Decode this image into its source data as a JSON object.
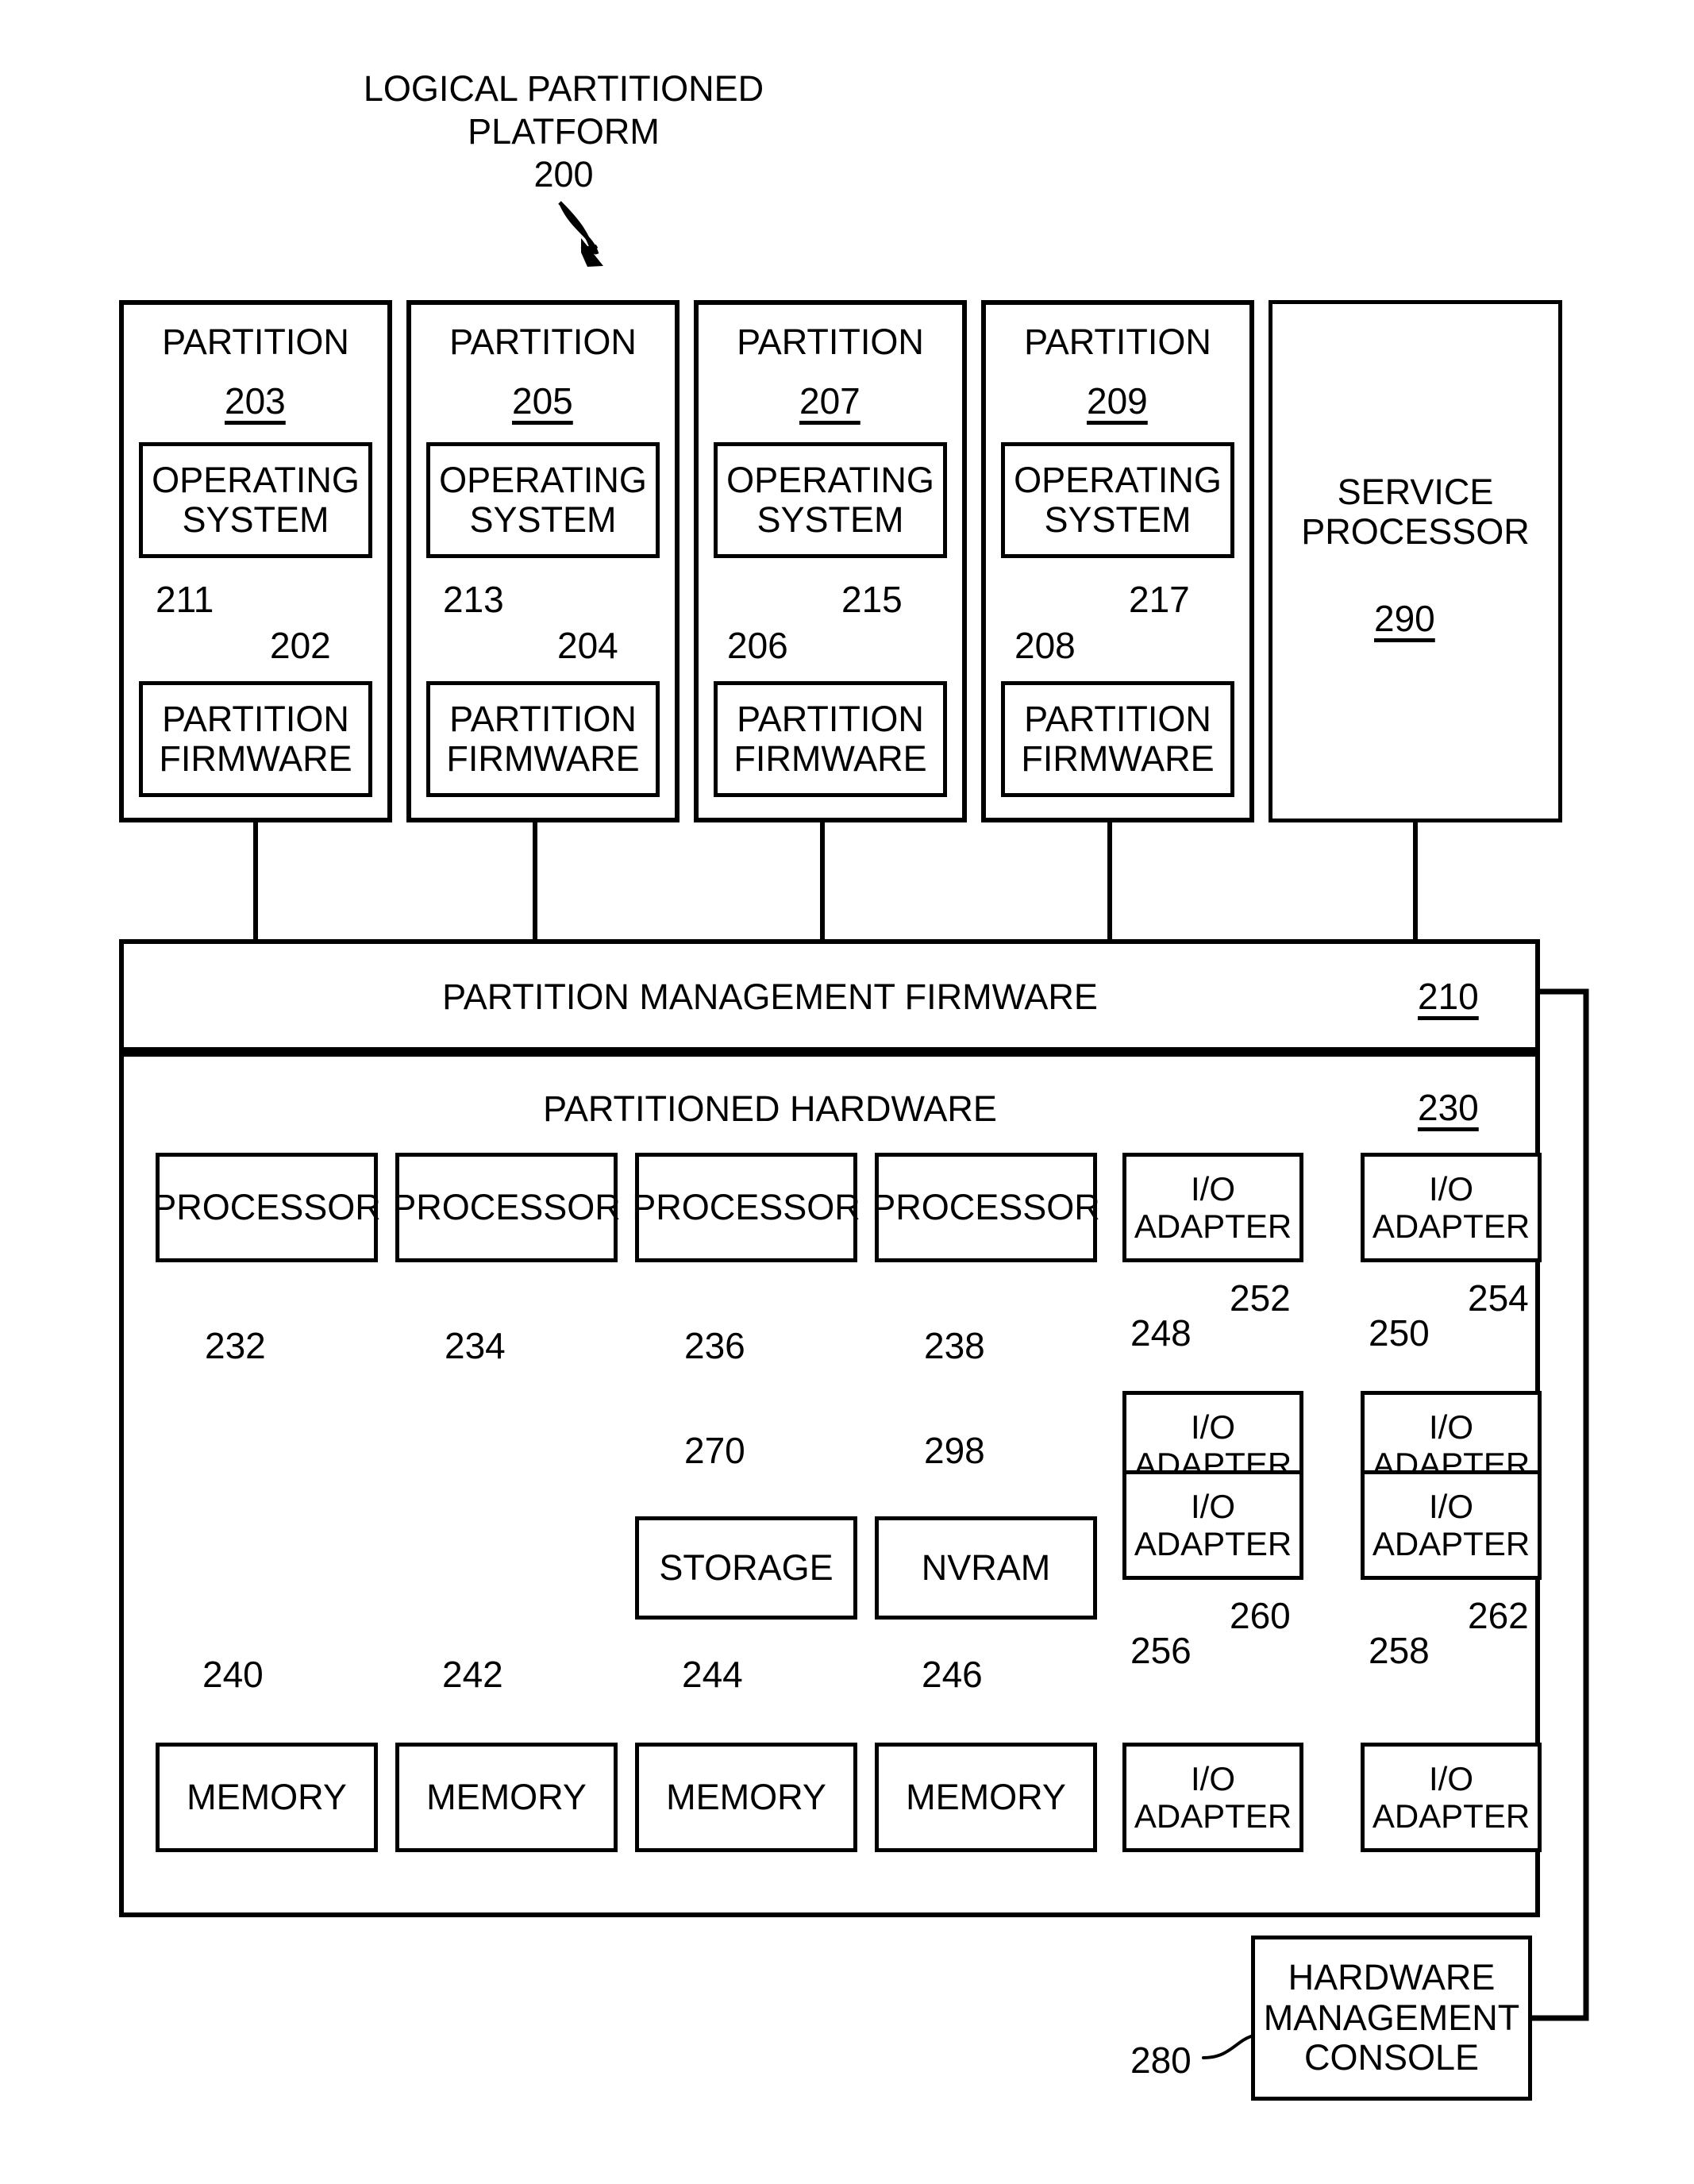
{
  "figure": {
    "title_line1": "LOGICAL PARTITIONED",
    "title_line2": "PLATFORM",
    "title_ref": "200"
  },
  "partitions": [
    {
      "name": "PARTITION",
      "ref": "203",
      "os_label_l1": "OPERATING",
      "os_label_l2": "SYSTEM",
      "fw_label_l1": "PARTITION",
      "fw_label_l2": "FIRMWARE",
      "ref_left": "211",
      "ref_right": "202"
    },
    {
      "name": "PARTITION",
      "ref": "205",
      "os_label_l1": "OPERATING",
      "os_label_l2": "SYSTEM",
      "fw_label_l1": "PARTITION",
      "fw_label_l2": "FIRMWARE",
      "ref_left": "213",
      "ref_right": "204"
    },
    {
      "name": "PARTITION",
      "ref": "207",
      "os_label_l1": "OPERATING",
      "os_label_l2": "SYSTEM",
      "fw_label_l1": "PARTITION",
      "fw_label_l2": "FIRMWARE",
      "ref_left": "206",
      "ref_right": "215"
    },
    {
      "name": "PARTITION",
      "ref": "209",
      "os_label_l1": "OPERATING",
      "os_label_l2": "SYSTEM",
      "fw_label_l1": "PARTITION",
      "fw_label_l2": "FIRMWARE",
      "ref_left": "208",
      "ref_right": "217"
    }
  ],
  "service_processor": {
    "label_l1": "SERVICE",
    "label_l2": "PROCESSOR",
    "ref": "290"
  },
  "partition_management_firmware": {
    "label": "PARTITION MANAGEMENT FIRMWARE",
    "ref": "210"
  },
  "partitioned_hardware": {
    "label": "PARTITIONED HARDWARE",
    "ref": "230",
    "processors": [
      {
        "label": "PROCESSOR",
        "ref": "232"
      },
      {
        "label": "PROCESSOR",
        "ref": "234"
      },
      {
        "label": "PROCESSOR",
        "ref": "236"
      },
      {
        "label": "PROCESSOR",
        "ref": "238"
      }
    ],
    "memories": [
      {
        "label": "MEMORY",
        "ref": "240"
      },
      {
        "label": "MEMORY",
        "ref": "242"
      },
      {
        "label": "MEMORY",
        "ref": "244"
      },
      {
        "label": "MEMORY",
        "ref": "246"
      }
    ],
    "storage": {
      "label": "STORAGE",
      "ref": "270"
    },
    "nvram": {
      "label": "NVRAM",
      "ref": "298"
    },
    "io_adapters": [
      {
        "label_l1": "I/O",
        "label_l2": "ADAPTER",
        "ref": "248"
      },
      {
        "label_l1": "I/O",
        "label_l2": "ADAPTER",
        "ref": "250"
      },
      {
        "label_l1": "I/O",
        "label_l2": "ADAPTER",
        "ref": "252"
      },
      {
        "label_l1": "I/O",
        "label_l2": "ADAPTER",
        "ref": "254"
      },
      {
        "label_l1": "I/O",
        "label_l2": "ADAPTER",
        "ref": "256"
      },
      {
        "label_l1": "I/O",
        "label_l2": "ADAPTER",
        "ref": "258"
      },
      {
        "label_l1": "I/O",
        "label_l2": "ADAPTER",
        "ref": "260"
      },
      {
        "label_l1": "I/O",
        "label_l2": "ADAPTER",
        "ref": "262"
      }
    ]
  },
  "hardware_management_console": {
    "label_l1": "HARDWARE",
    "label_l2": "MANAGEMENT",
    "label_l3": "CONSOLE",
    "ref": "280"
  },
  "colors": {
    "ink": "#000000",
    "paper": "#ffffff"
  }
}
